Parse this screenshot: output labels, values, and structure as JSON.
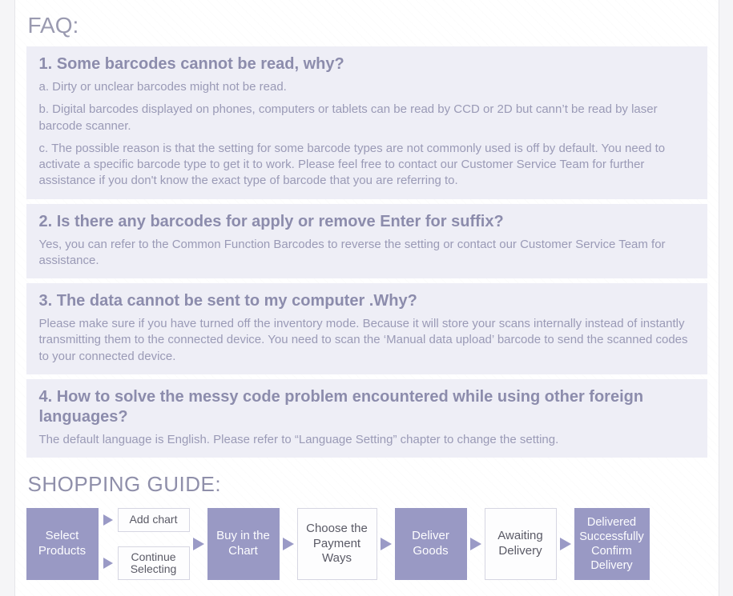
{
  "faq": {
    "title": "FAQ:",
    "items": [
      {
        "q": "1. Some barcodes cannot be read, why?",
        "a": [
          "a. Dirty or unclear barcodes might not be read.",
          "b. Digital barcodes displayed on phones, computers or tablets can be read by CCD or 2D but cann’t  be read by laser barcode scanner.",
          "c. The possible reason is that the setting for some barcode types are not commonly used is off by default. You need to activate a specific barcode type to get it to work. Please feel free to contact our Customer Service Team for further assistance if you don't know the exact type of barcode that you are referring to."
        ]
      },
      {
        "q": "2. Is there any barcodes for apply or remove Enter for suffix?",
        "a": [
          "Yes, you can refer to the Common Function Barcodes to reverse the setting or contact our Customer Service Team for assistance."
        ]
      },
      {
        "q": "3. The data cannot be sent to my computer .Why?",
        "a": [
          "Please make sure if you have turned off the inventory mode. Because it will store your scans internally instead of instantly transmitting them to the connected device. You need to scan the ‘Manual data upload’ barcode to send the scanned codes to your connected device."
        ]
      },
      {
        "q": "4. How to solve the messy code problem encountered while using other foreign languages?",
        "a": [
          "The default language is English. Please refer to “Language Setting” chapter to change the setting."
        ]
      }
    ]
  },
  "guide": {
    "title": "SHOPPING GUIDE:",
    "steps": {
      "select": "Select Products",
      "add": "Add chart",
      "continue": "Continue Selecting",
      "buy": "Buy in the Chart",
      "pay": "Choose the Payment Ways",
      "deliver": "Deliver Goods",
      "await": "Awaiting Delivery",
      "done": "Delivered Successfully Confirm Delivery"
    }
  }
}
